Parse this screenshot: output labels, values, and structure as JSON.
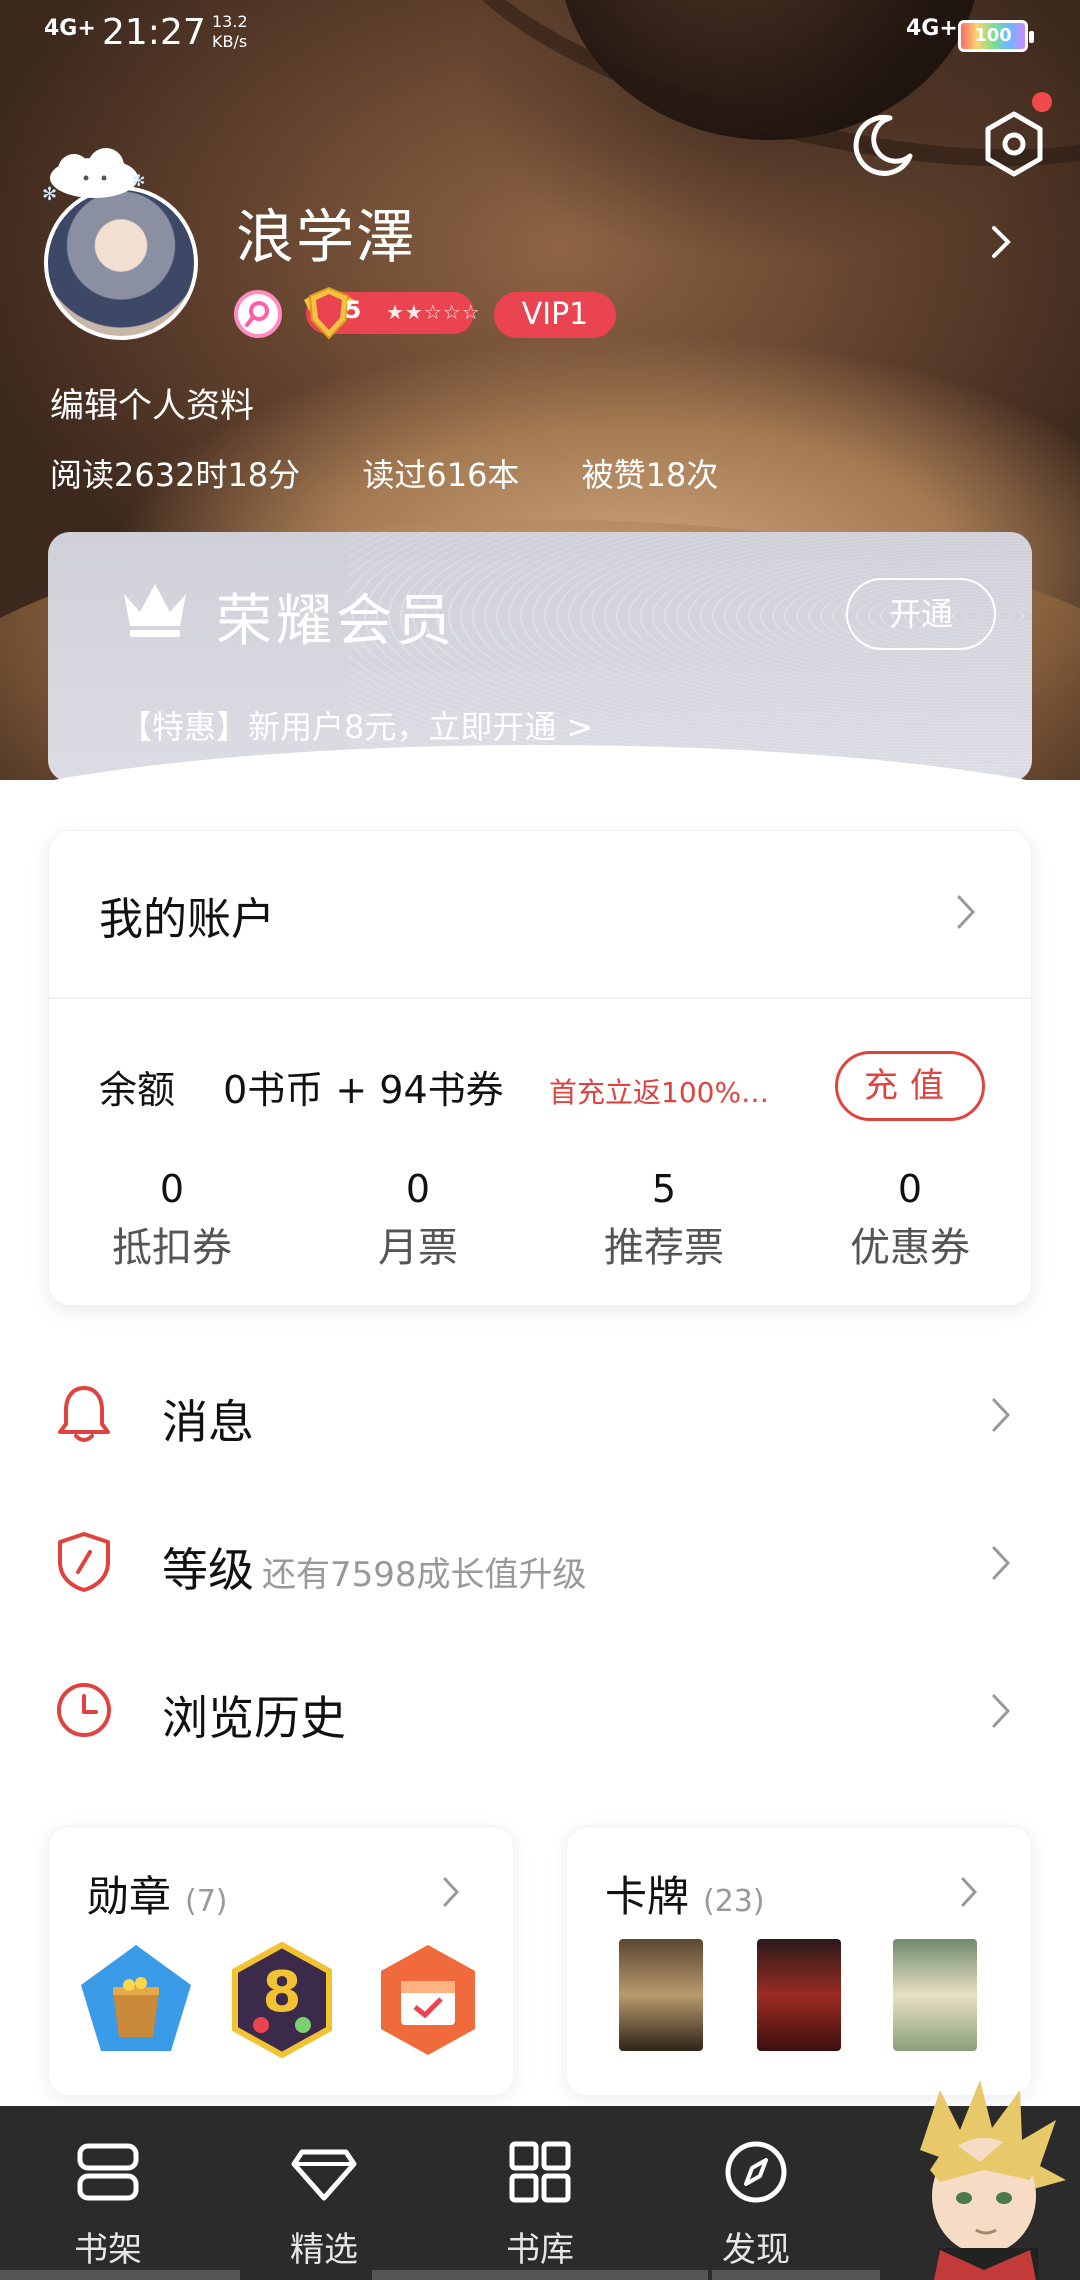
{
  "status_bar": {
    "signal": "4G+",
    "time": "21:27",
    "speed": "13.2",
    "speed_unit": "KB/s",
    "network": "4G+",
    "battery": "100"
  },
  "header": {
    "username": "浪学澤",
    "vip_level": "VIP1",
    "user_level": "5",
    "edit_profile": "编辑个人资料",
    "stats": [
      "阅读2632时18分",
      "读过616本",
      "被赞18次"
    ],
    "has_notification": true
  },
  "vip_card": {
    "title": "荣耀会员",
    "open_button": "开通",
    "promo": "【特惠】新用户8元，立即开通 >"
  },
  "account": {
    "title": "我的账户",
    "balance_label": "余额",
    "balance_value": "0书币 + 94书券",
    "promo": "首充立返100%…",
    "recharge_button": "充值",
    "coupons": [
      {
        "value": "0",
        "label": "抵扣券"
      },
      {
        "value": "0",
        "label": "月票"
      },
      {
        "value": "5",
        "label": "推荐票"
      },
      {
        "value": "0",
        "label": "优惠券"
      }
    ]
  },
  "menu": {
    "messages": "消息",
    "level": "等级",
    "level_hint": "还有7598成长值升级",
    "history": "浏览历史"
  },
  "badges": {
    "title": "勋章",
    "count": "(7)"
  },
  "cards": {
    "title": "卡牌",
    "count": "(23)"
  },
  "nav": {
    "items": [
      "书架",
      "精选",
      "书库",
      "发现"
    ]
  },
  "colors": {
    "accent_red": "#e0433f",
    "vip_red": "#e9444f",
    "nav_bg": "#2b2b2b"
  }
}
